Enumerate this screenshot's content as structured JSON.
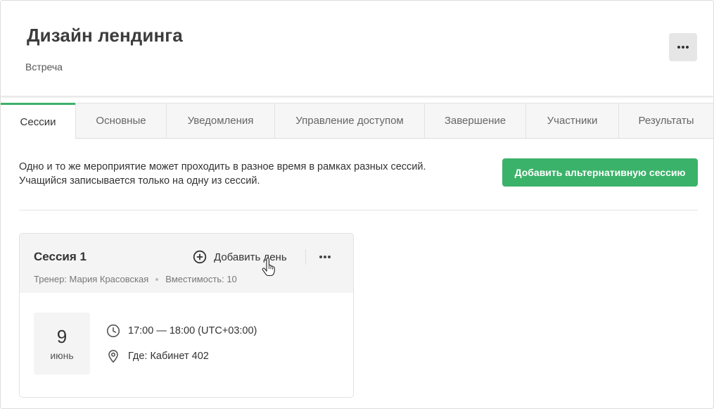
{
  "header": {
    "title": "Дизайн лендинга",
    "subtitle": "Встреча",
    "more_icon": "more-horizontal-icon"
  },
  "tabs": [
    {
      "label": "Сессии",
      "active": true
    },
    {
      "label": "Основные",
      "active": false
    },
    {
      "label": "Уведомления",
      "active": false
    },
    {
      "label": "Управление доступом",
      "active": false
    },
    {
      "label": "Завершение",
      "active": false
    },
    {
      "label": "Участники",
      "active": false
    },
    {
      "label": "Результаты",
      "active": false
    }
  ],
  "info": {
    "line1": "Одно и то же мероприятие может проходить в разное время в рамках разных сессий.",
    "line2": "Учащийся записывается только на одну из сессий."
  },
  "actions": {
    "add_session_label": "Добавить альтернативную сессию"
  },
  "session": {
    "title": "Сессия 1",
    "trainer": "Тренер: Мария Красовская",
    "capacity": "Вместимость: 10",
    "add_day_label": "Добавить день",
    "day": {
      "date": "9",
      "month": "июнь",
      "time": "17:00 — 18:00 (UTC+03:00)",
      "location": "Где: Кабинет 402"
    }
  },
  "colors": {
    "accent": "#3bb26a",
    "tab_inactive_bg": "#f6f6f6",
    "card_head_bg": "#f4f4f4"
  }
}
